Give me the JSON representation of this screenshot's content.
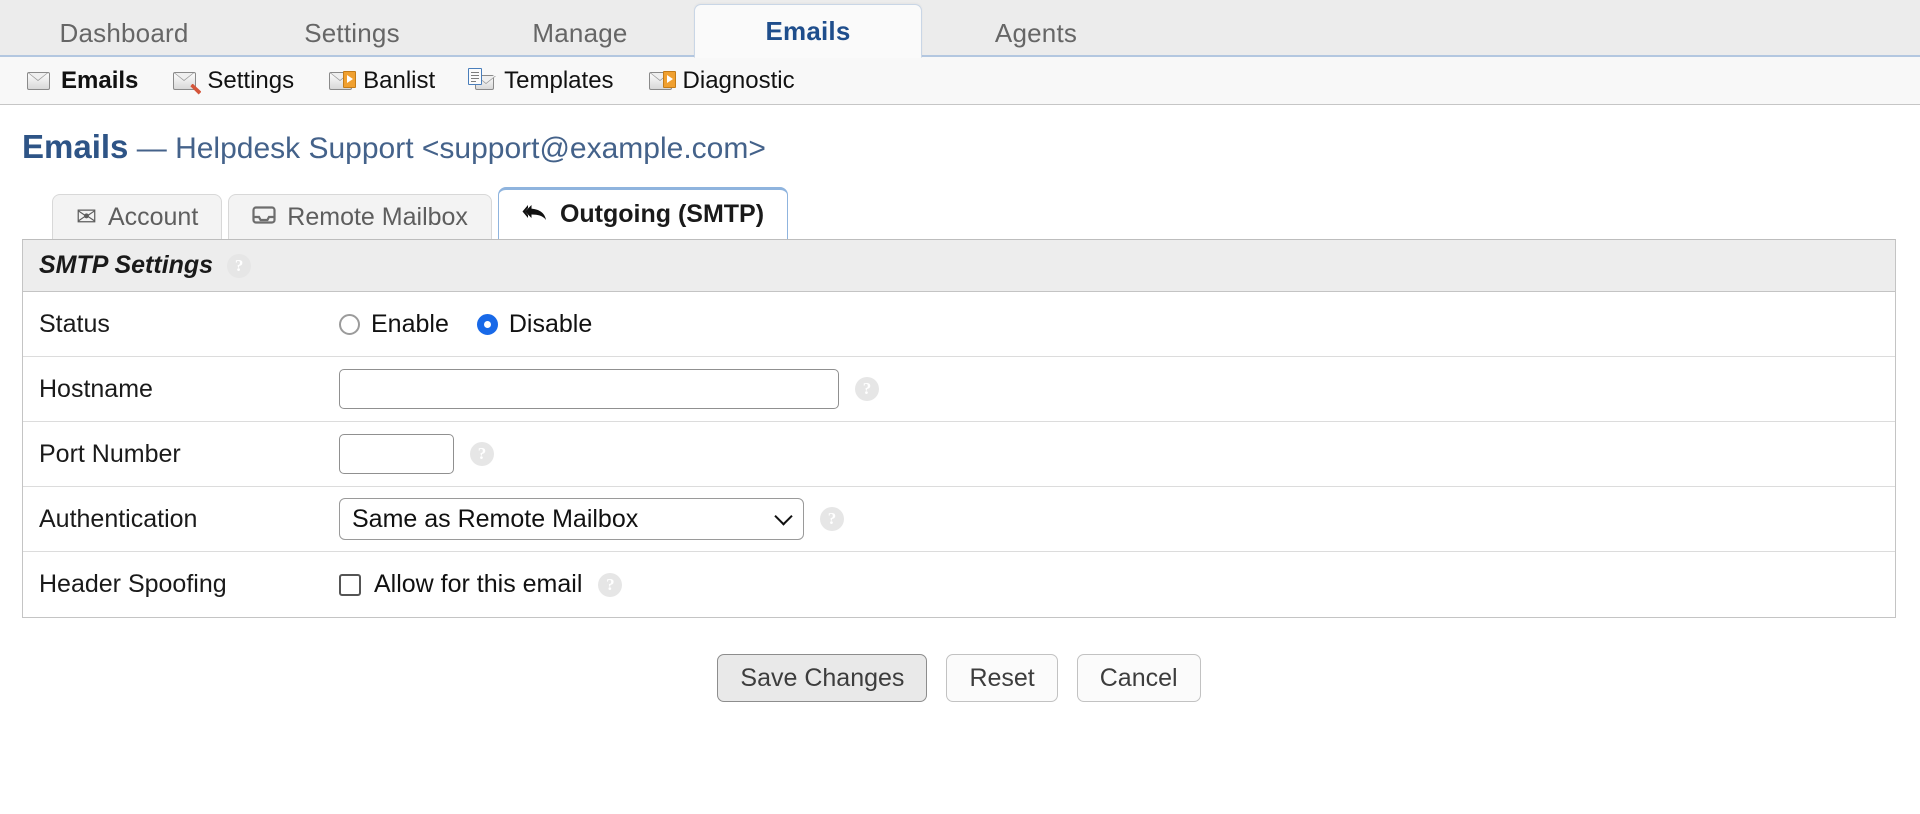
{
  "top_nav": {
    "tabs": [
      {
        "label": "Dashboard",
        "active": false
      },
      {
        "label": "Settings",
        "active": false
      },
      {
        "label": "Manage",
        "active": false
      },
      {
        "label": "Emails",
        "active": true
      },
      {
        "label": "Agents",
        "active": false
      }
    ]
  },
  "sub_nav": {
    "items": [
      {
        "label": "Emails",
        "icon": "envelope-icon",
        "current": true
      },
      {
        "label": "Settings",
        "icon": "envelope-wrench-icon",
        "current": false
      },
      {
        "label": "Banlist",
        "icon": "envelope-arrow-icon",
        "current": false
      },
      {
        "label": "Templates",
        "icon": "envelope-document-icon",
        "current": false
      },
      {
        "label": "Diagnostic",
        "icon": "envelope-arrow-icon",
        "current": false
      }
    ]
  },
  "page": {
    "title": "Emails",
    "separator": " — ",
    "subtitle": "Helpdesk Support <support@example.com>"
  },
  "sub_tabs": [
    {
      "label": "Account",
      "icon": "envelope-icon",
      "glyph": "✉",
      "active": false
    },
    {
      "label": "Remote Mailbox",
      "icon": "inbox-icon",
      "glyph": "⏷",
      "active": false
    },
    {
      "label": "Outgoing (SMTP)",
      "icon": "reply-all-icon",
      "glyph": "↶",
      "active": true
    }
  ],
  "panel": {
    "heading": "SMTP Settings",
    "heading_help": "?",
    "rows": {
      "status": {
        "label": "Status",
        "options": [
          {
            "label": "Enable",
            "selected": false
          },
          {
            "label": "Disable",
            "selected": true
          }
        ]
      },
      "hostname": {
        "label": "Hostname",
        "value": "",
        "placeholder": "",
        "help": "?"
      },
      "port": {
        "label": "Port Number",
        "value": "",
        "placeholder": "",
        "help": "?"
      },
      "authentication": {
        "label": "Authentication",
        "selected": "Same as Remote Mailbox",
        "help": "?"
      },
      "header_spoofing": {
        "label": "Header Spoofing",
        "checkbox_label": "Allow for this email",
        "checked": false,
        "help": "?"
      }
    }
  },
  "buttons": {
    "save": "Save Changes",
    "reset": "Reset",
    "cancel": "Cancel"
  },
  "colors": {
    "accent": "#1f4e8c",
    "title": "#3a5a80",
    "radio_on": "#1869e8",
    "active_tab_border": "#8fb4de"
  }
}
